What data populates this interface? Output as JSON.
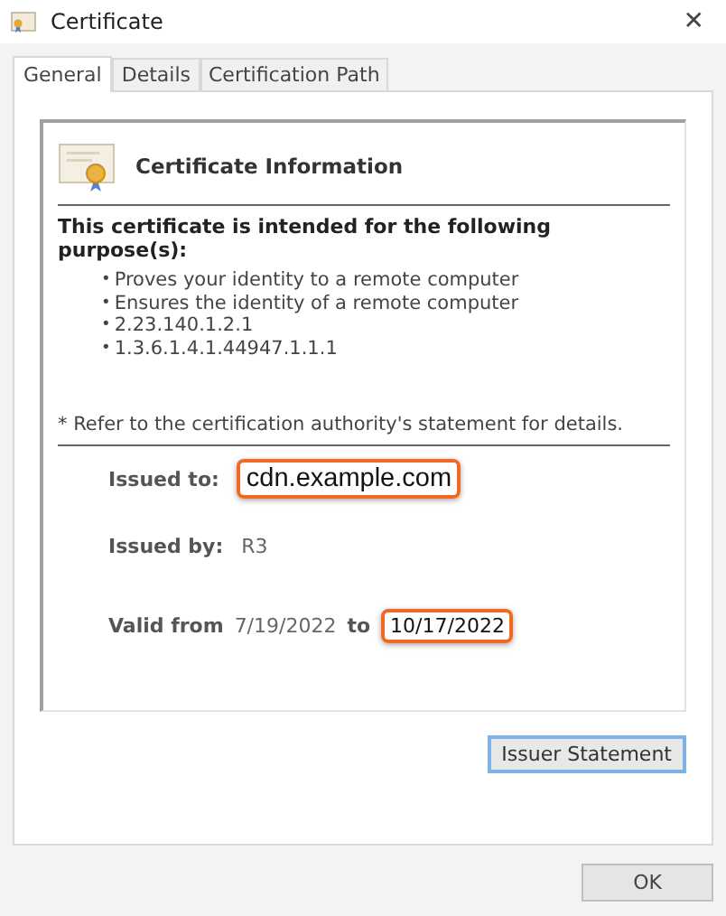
{
  "window": {
    "title": "Certificate",
    "close": "✕"
  },
  "tabs": [
    {
      "label": "General",
      "selected": true
    },
    {
      "label": "Details",
      "selected": false
    },
    {
      "label": "Certification Path",
      "selected": false
    }
  ],
  "info": {
    "heading": "Certificate Information",
    "purpose_title": "This certificate is intended for the following purpose(s):",
    "purposes": [
      "Proves your identity to a remote computer",
      "Ensures the identity of a remote computer",
      "2.23.140.1.2.1",
      "1.3.6.1.4.1.44947.1.1.1"
    ],
    "bullet": "•",
    "note": "* Refer to the certification authority's statement for details.",
    "issued_to": {
      "label": "Issued to:",
      "value": "cdn.example.com",
      "highlighted": true
    },
    "issued_by": {
      "label": "Issued by:",
      "value": "R3",
      "highlighted": false
    },
    "valid_from": {
      "label": "Valid from",
      "value": "7/19/2022",
      "highlighted": false
    },
    "valid_to": {
      "label": "to",
      "value": "10/17/2022",
      "highlighted": true
    }
  },
  "issuer_button": "Issuer Statement",
  "ok_button": "OK"
}
